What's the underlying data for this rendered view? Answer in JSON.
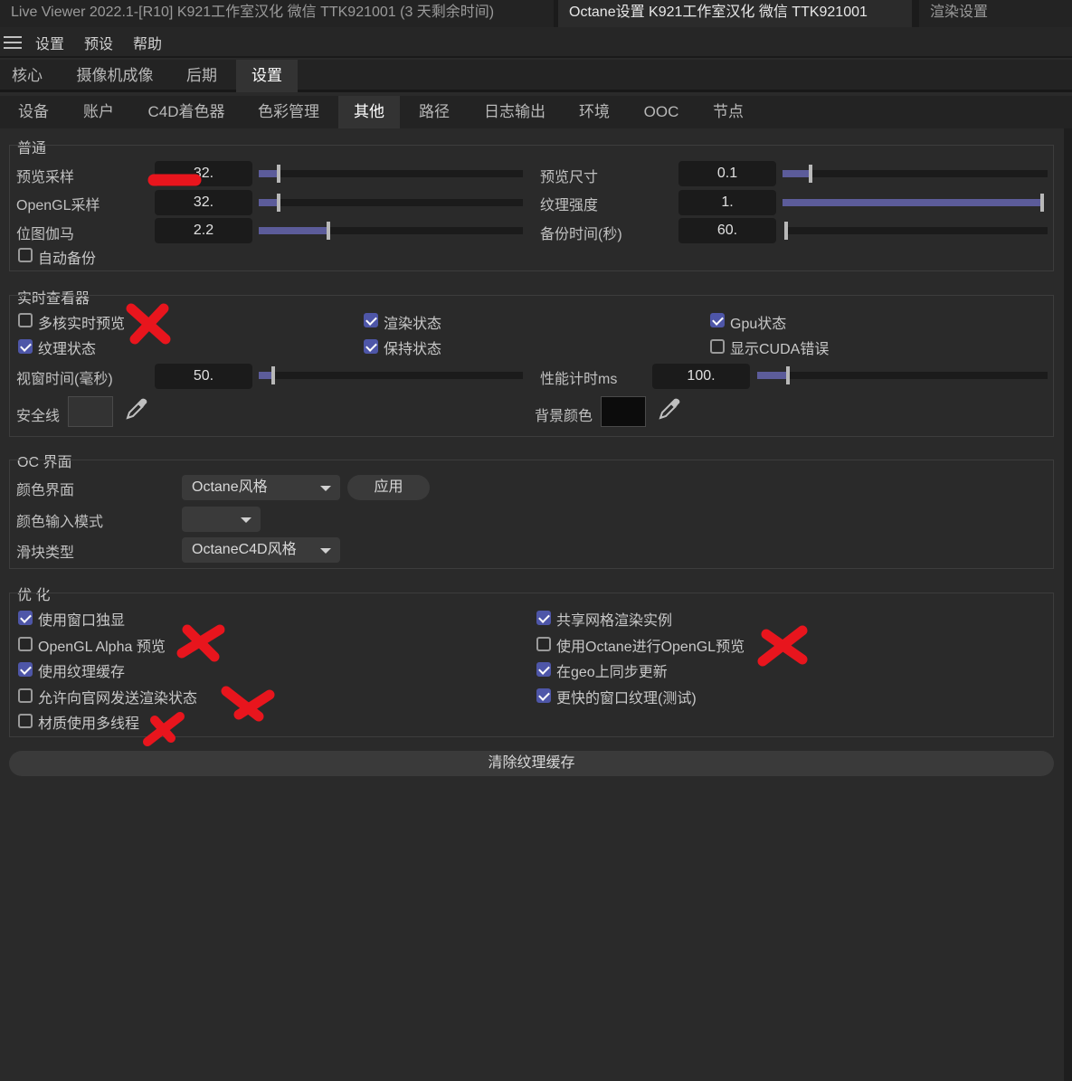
{
  "window_tabs": [
    {
      "label": "Live Viewer 2022.1-[R10]  K921工作室汉化  微信  TTK921001 (3 天剩余时间)"
    },
    {
      "label": "Octane设置  K921工作室汉化  微信  TTK921001"
    },
    {
      "label": "渲染设置"
    }
  ],
  "menu": {
    "items": [
      "设置",
      "预设",
      "帮助"
    ]
  },
  "main_tabs": [
    "核心",
    "摄像机成像",
    "后期",
    "设置"
  ],
  "sub_tabs": [
    "设备",
    "账户",
    "C4D着色器",
    "色彩管理",
    "其他",
    "路径",
    "日志输出",
    "环境",
    "OOC",
    "节点"
  ],
  "general": {
    "title": "普通",
    "preview_samples": {
      "label": "预览采样",
      "value": "32.",
      "fraction": 0.07
    },
    "opengl_samples": {
      "label": "OpenGL采样",
      "value": "32.",
      "fraction": 0.07
    },
    "bitmap_gamma": {
      "label": "位图伽马",
      "value": "2.2",
      "fraction": 0.26
    },
    "preview_size": {
      "label": "预览尺寸",
      "value": "0.1",
      "fraction": 0.1
    },
    "texture_strength": {
      "label": "纹理强度",
      "value": "1.",
      "fraction": 1.0
    },
    "backup_time": {
      "label": "备份时间(秒)",
      "value": "60.",
      "fraction": 0.0
    },
    "auto_backup": {
      "label": "自动备份",
      "checked": false
    }
  },
  "live_viewer": {
    "title": "实时查看器",
    "multicore_preview": {
      "label": "多核实时预览",
      "checked": false
    },
    "render_status": {
      "label": "渲染状态",
      "checked": true
    },
    "gpu_status": {
      "label": "Gpu状态",
      "checked": true
    },
    "texture_status": {
      "label": "纹理状态",
      "checked": true
    },
    "keep_status": {
      "label": "保持状态",
      "checked": true
    },
    "show_cuda_errors": {
      "label": "显示CUDA错误",
      "checked": false
    },
    "viewport_time": {
      "label": "视窗时间(毫秒)",
      "value": "50.",
      "fraction": 0.05
    },
    "perf_timer": {
      "label": "性能计时ms",
      "value": "100.",
      "fraction": 0.1
    },
    "safe_line": {
      "label": "安全线",
      "color": "#333333"
    },
    "bg_color": {
      "label": "背景颜色",
      "color": "#0c0c0c"
    }
  },
  "oc_interface": {
    "title": "OC 界面",
    "color_interface": {
      "label": "颜色界面",
      "value": "Octane风格"
    },
    "apply_button": "应用",
    "color_input_mode": {
      "label": "颜色输入模式",
      "value": ""
    },
    "slider_type": {
      "label": "滑块类型",
      "value": "OctaneC4D风格"
    }
  },
  "optimization": {
    "title": "优 化",
    "window_solo": {
      "label": "使用窗口独显",
      "checked": true
    },
    "opengl_alpha": {
      "label": "OpenGL Alpha 预览",
      "checked": false
    },
    "texture_cache": {
      "label": "使用纹理缓存",
      "checked": true
    },
    "send_render_status": {
      "label": "允许向官网发送渲染状态",
      "checked": false
    },
    "material_multithread": {
      "label": "材质使用多线程",
      "checked": false
    },
    "share_mesh_instances": {
      "label": "共享网格渲染实例",
      "checked": true
    },
    "octane_opengl_preview": {
      "label": "使用Octane进行OpenGL预览",
      "checked": false
    },
    "geo_sync_update": {
      "label": "在geo上同步更新",
      "checked": true
    },
    "faster_viewport_texture": {
      "label": "更快的窗口纹理(测试)",
      "checked": true
    }
  },
  "clear_cache_button": "清除纹理缓存",
  "colors": {
    "accent": "#5c5c9a",
    "checkbox_on": "#4e56a8",
    "annotation_red": "#e8151d"
  }
}
